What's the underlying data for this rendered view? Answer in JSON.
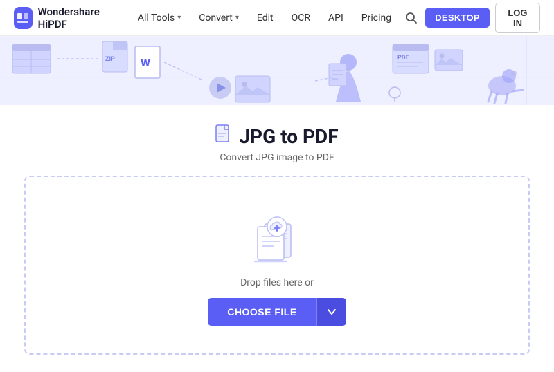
{
  "header": {
    "logo_text": "Wondershare HiPDF",
    "nav_items": [
      {
        "label": "All Tools",
        "has_dropdown": true
      },
      {
        "label": "Convert",
        "has_dropdown": true
      },
      {
        "label": "Edit",
        "has_dropdown": false
      },
      {
        "label": "OCR",
        "has_dropdown": false
      },
      {
        "label": "API",
        "has_dropdown": false
      },
      {
        "label": "Pricing",
        "has_dropdown": false
      }
    ],
    "desktop_btn": "DESKTOP",
    "login_btn": "LOG IN"
  },
  "page": {
    "title": "JPG to PDF",
    "subtitle": "Convert JPG image to PDF",
    "drop_text": "Drop files here or",
    "choose_file_btn": "CHOOSE FILE"
  }
}
